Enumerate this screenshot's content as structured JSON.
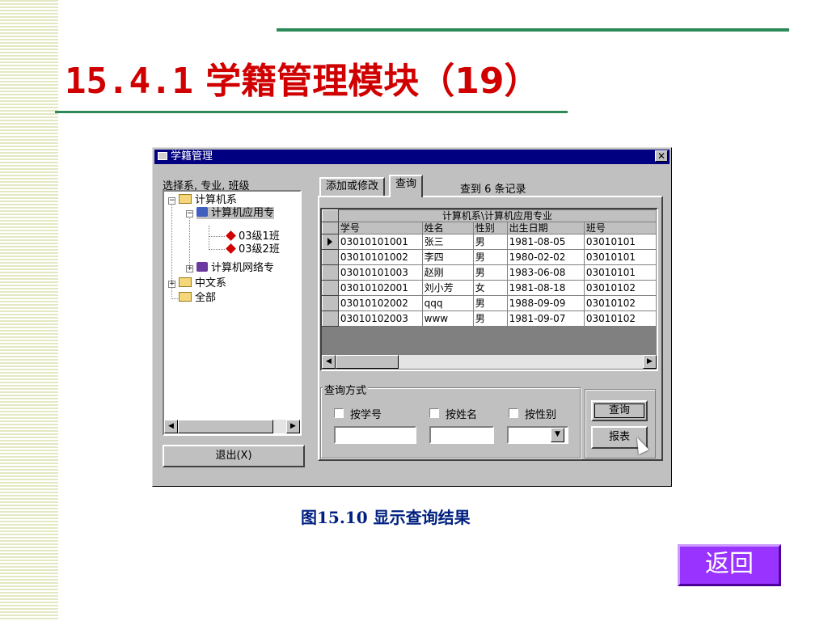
{
  "slide": {
    "title_number": "15.4.1",
    "title_text": "学籍管理模块（19）",
    "caption": "图15.10   显示查询结果",
    "back_button": "返回"
  },
  "dialog": {
    "title": "学籍管理",
    "close_glyph": "✕",
    "tree_label": "选择系, 专业, 班级",
    "tree": [
      {
        "label": "计算机系"
      },
      {
        "label": "计算机应用专"
      },
      {
        "label": "03级1班"
      },
      {
        "label": "03级2班"
      },
      {
        "label": "计算机网络专"
      },
      {
        "label": "中文系"
      },
      {
        "label": "全部"
      }
    ],
    "exit_button": "退出(X)",
    "tabs": [
      "添加或修改",
      "查询"
    ],
    "record_count": "查到 6 条记录",
    "grid": {
      "caption": "计算机系\\计算机应用专业",
      "columns": [
        "学号",
        "姓名",
        "性别",
        "出生日期",
        "班号"
      ],
      "rows": [
        [
          "03010101001",
          "张三",
          "男",
          "1981-08-05",
          "03010101"
        ],
        [
          "03010101002",
          "李四",
          "男",
          "1980-02-02",
          "03010101"
        ],
        [
          "03010101003",
          "赵刚",
          "男",
          "1983-06-08",
          "03010101"
        ],
        [
          "03010102001",
          "刘小芳",
          "女",
          "1981-08-18",
          "03010102"
        ],
        [
          "03010102002",
          "qqq",
          "男",
          "1988-09-09",
          "03010102"
        ],
        [
          "03010102003",
          "www",
          "男",
          "1981-09-07",
          "03010102"
        ]
      ]
    },
    "query": {
      "group_title": "查询方式",
      "by_id": "按学号",
      "by_name": "按姓名",
      "by_gender": "按性别",
      "query_button": "查询",
      "report_button": "报表"
    }
  }
}
